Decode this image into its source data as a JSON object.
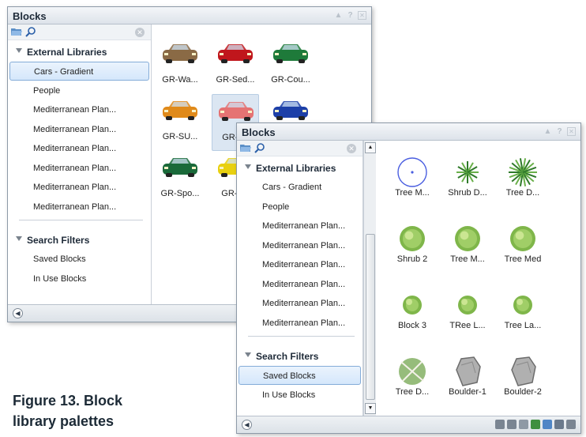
{
  "back_palette": {
    "title": "Blocks",
    "titlebar_icons": [
      "pin-icon",
      "help-icon",
      "close-icon"
    ],
    "sections": [
      {
        "header": "External Libraries",
        "items": [
          "Cars - Gradient",
          "People",
          "Mediterranean Plan...",
          "Mediterranean Plan...",
          "Mediterranean Plan...",
          "Mediterranean Plan...",
          "Mediterranean Plan...",
          "Mediterranean Plan..."
        ],
        "selected_index": 0
      },
      {
        "header": "Search Filters",
        "items": [
          "Saved Blocks",
          "In Use Blocks"
        ]
      }
    ],
    "blocks": [
      {
        "label": "GR-Wa...",
        "icon": "van-icon",
        "color": "#8a6a45"
      },
      {
        "label": "GR-Sed...",
        "icon": "sedan-icon",
        "color": "#c0161c"
      },
      {
        "label": "GR-Cou...",
        "icon": "coupe-icon",
        "color": "#1e7a3a"
      },
      {
        "label": "GR-SU...",
        "icon": "suv-icon",
        "color": "#e08a1a"
      },
      {
        "label": "GR-Se",
        "icon": "sedan-icon",
        "color": "#e57373"
      },
      {
        "label": "",
        "icon": "car-icon",
        "color": "#1c3fa8"
      },
      {
        "label": "GR-Spo...",
        "icon": "sports-car-icon",
        "color": "#1a6a3a"
      },
      {
        "label": "GR-SU",
        "icon": "suv-icon",
        "color": "#e8d010"
      }
    ]
  },
  "front_palette": {
    "title": "Blocks",
    "titlebar_icons": [
      "pin-icon",
      "help-icon",
      "close-icon"
    ],
    "sections": [
      {
        "header": "External Libraries",
        "items": [
          "Cars - Gradient",
          "People",
          "Mediterranean Plan...",
          "Mediterranean Plan...",
          "Mediterranean Plan...",
          "Mediterranean Plan...",
          "Mediterranean Plan...",
          "Mediterranean Plan..."
        ]
      },
      {
        "header": "Search Filters",
        "items": [
          "Saved Blocks",
          "In Use Blocks"
        ],
        "selected_index": 0
      }
    ],
    "blocks": [
      {
        "label": "Tree M...",
        "icon": "tree-outline-icon"
      },
      {
        "label": "Shrub D...",
        "icon": "shrub-spiky-icon"
      },
      {
        "label": "Tree D...",
        "icon": "tree-palm-icon"
      },
      {
        "label": "Shrub 2",
        "icon": "shrub-round-icon"
      },
      {
        "label": "Tree M...",
        "icon": "tree-round-icon"
      },
      {
        "label": "Tree Med",
        "icon": "tree-round-icon"
      },
      {
        "label": "Block 3",
        "icon": "tree-small-icon"
      },
      {
        "label": "TRee L...",
        "icon": "tree-small-icon"
      },
      {
        "label": "Tree La...",
        "icon": "tree-small-icon"
      },
      {
        "label": "Tree D...",
        "icon": "tree-dead-icon"
      },
      {
        "label": "Boulder-1",
        "icon": "boulder-icon"
      },
      {
        "label": "Boulder-2",
        "icon": "boulder-icon"
      }
    ],
    "bottom_icons": [
      "block-icon",
      "block-icon",
      "block-icon",
      "tree-icon",
      "folder-icon",
      "export-icon",
      "trash-icon"
    ]
  },
  "caption_line1": "Figure 13. Block",
  "caption_line2": "library palettes"
}
